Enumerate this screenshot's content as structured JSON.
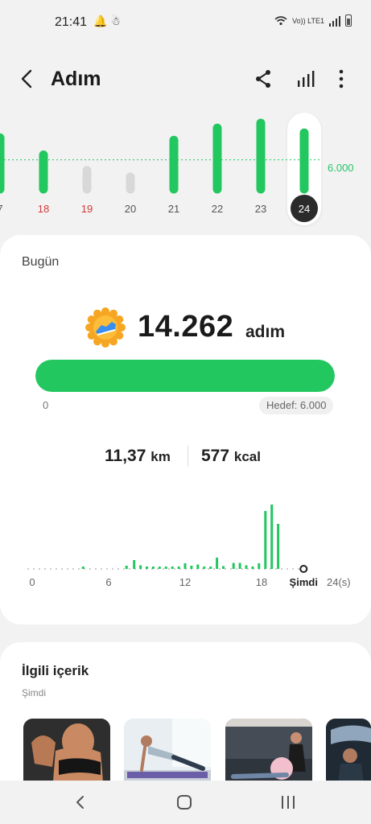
{
  "status": {
    "time": "21:41",
    "notification_icons": "🔔 ☃",
    "network": "Vo)) LTE1"
  },
  "header": {
    "title": "Adım"
  },
  "week": {
    "goal_label": "6.000",
    "days": [
      {
        "label": "7",
        "color": "#555555",
        "value": 10500,
        "met": true
      },
      {
        "label": "18",
        "color": "#d23b3b",
        "value": 7000,
        "met": true
      },
      {
        "label": "19",
        "color": "#d23b3b",
        "value": 3800,
        "met": false
      },
      {
        "label": "20",
        "color": "#555555",
        "value": 2500,
        "met": false
      },
      {
        "label": "21",
        "color": "#555555",
        "value": 10000,
        "met": true
      },
      {
        "label": "22",
        "color": "#555555",
        "value": 12500,
        "met": true
      },
      {
        "label": "23",
        "color": "#555555",
        "value": 13500,
        "met": true
      },
      {
        "label": "24",
        "color": "#ffffff",
        "value": 11500,
        "met": true,
        "selected": true
      }
    ],
    "goal_value": 6000,
    "max_value": 14000
  },
  "today": {
    "label": "Bugün",
    "steps": "14.262",
    "steps_unit": "adım",
    "progress_fraction": 1.0,
    "progress_zero": "0",
    "goal_text": "Hedef: 6.000",
    "distance_value": "11,37",
    "distance_unit": "km",
    "calories_value": "577",
    "calories_unit": "kcal"
  },
  "chart_data": {
    "type": "bar",
    "title": "",
    "xlabel": "",
    "ylabel": "",
    "x_tick_labels": [
      "0",
      "6",
      "12",
      "18",
      "Şimdi",
      "24(s)"
    ],
    "x_range": [
      0,
      24
    ],
    "bins_per_hour": 3,
    "values": [
      0,
      0,
      0,
      0,
      0,
      0,
      0,
      0,
      0,
      0,
      0,
      0,
      0,
      0,
      0,
      0,
      0,
      0,
      0,
      0,
      0,
      40,
      0,
      0,
      0,
      0,
      0,
      50,
      0,
      0,
      0,
      0,
      0,
      0,
      0,
      0,
      0,
      0,
      0,
      0,
      0,
      60,
      0,
      0,
      0,
      0,
      0,
      0,
      0,
      120,
      0,
      0,
      0,
      0,
      0,
      0,
      150,
      0,
      0,
      0,
      0,
      0,
      0,
      40,
      0,
      0,
      0,
      0,
      0,
      0,
      0,
      0,
      0,
      0,
      0,
      0,
      0,
      0,
      0,
      0,
      0,
      0,
      0,
      0,
      0,
      0,
      0,
      0,
      0,
      0,
      0,
      0,
      0,
      0,
      0,
      0,
      0,
      0,
      0,
      0,
      0,
      0,
      0,
      0,
      0,
      0,
      0,
      0,
      0,
      0,
      0,
      0
    ],
    "bars": [
      {
        "hour": 4.0,
        "value": 20
      },
      {
        "hour": 7.4,
        "value": 40
      },
      {
        "hour": 8.0,
        "value": 110
      },
      {
        "hour": 8.5,
        "value": 45
      },
      {
        "hour": 9.0,
        "value": 30
      },
      {
        "hour": 9.5,
        "value": 30
      },
      {
        "hour": 10.0,
        "value": 25
      },
      {
        "hour": 10.5,
        "value": 20
      },
      {
        "hour": 11.0,
        "value": 20
      },
      {
        "hour": 11.5,
        "value": 25
      },
      {
        "hour": 12.0,
        "value": 70
      },
      {
        "hour": 12.5,
        "value": 40
      },
      {
        "hour": 13.0,
        "value": 55
      },
      {
        "hour": 13.5,
        "value": 30
      },
      {
        "hour": 14.0,
        "value": 25
      },
      {
        "hour": 14.5,
        "value": 140
      },
      {
        "hour": 15.0,
        "value": 35
      },
      {
        "hour": 15.8,
        "value": 75
      },
      {
        "hour": 16.3,
        "value": 75
      },
      {
        "hour": 16.8,
        "value": 45
      },
      {
        "hour": 17.3,
        "value": 30
      },
      {
        "hour": 17.8,
        "value": 70
      },
      {
        "hour": 18.3,
        "value": 720
      },
      {
        "hour": 18.8,
        "value": 800
      },
      {
        "hour": 19.3,
        "value": 560
      }
    ],
    "now_hour": 21.3
  },
  "related": {
    "title": "İlgili içerik",
    "subtitle": "Şimdi"
  },
  "icons": {
    "back": "chevron-left-icon",
    "share": "share-icon",
    "stats": "bar-chart-icon",
    "more": "more-vert-icon",
    "badge": "running-shoe-badge-icon"
  },
  "colors": {
    "accent": "#22c75f",
    "inactive_bar": "#d8d8d8",
    "weekend_label": "#d23b3b"
  }
}
